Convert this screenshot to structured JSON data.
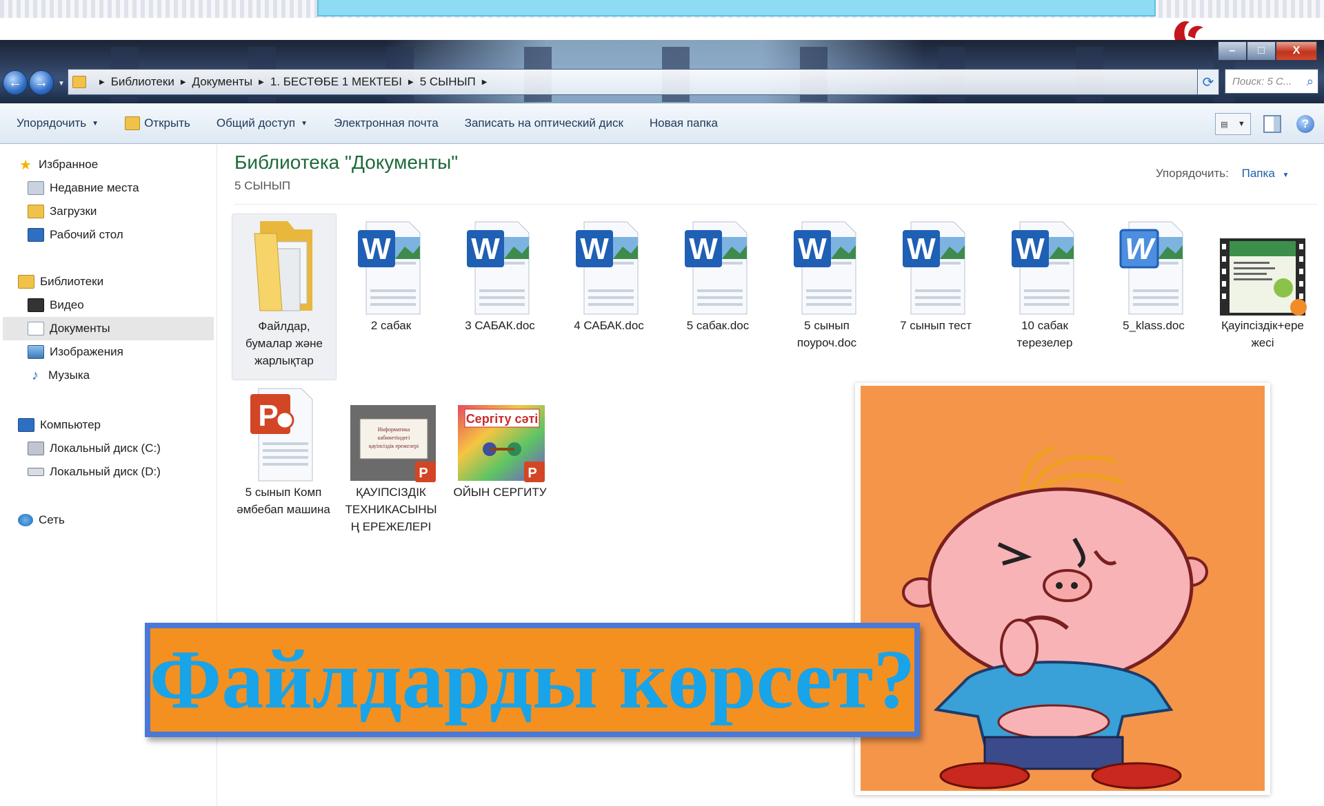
{
  "window": {
    "controls": {
      "minimize": "–",
      "maximize": "□",
      "close": "X"
    },
    "nav": {
      "back": "←",
      "forward": "→"
    },
    "address": {
      "crumbs": [
        "Библиотеки",
        "Документы",
        "1. БЕСТӨБЕ 1 МЕКТЕБІ",
        "5 СЫНЫП"
      ]
    },
    "search_placeholder": "Поиск: 5 С...",
    "refresh": "⟳"
  },
  "toolbar": {
    "organize": "Упорядочить",
    "open": "Открыть",
    "share": "Общий доступ",
    "email": "Электронная почта",
    "burn": "Записать на оптический диск",
    "new_folder": "Новая папка",
    "help": "?"
  },
  "sidebar": {
    "favorites": {
      "header": "Избранное",
      "items": [
        "Недавние места",
        "Загрузки",
        "Рабочий стол"
      ]
    },
    "libraries": {
      "header": "Библиотеки",
      "items": [
        "Видео",
        "Документы",
        "Изображения",
        "Музыка"
      ],
      "selected": "Документы"
    },
    "computer": {
      "header": "Компьютер",
      "items": [
        "Локальный диск (C:)",
        "Локальный диск (D:)"
      ]
    },
    "network": {
      "header": "Сеть"
    }
  },
  "content": {
    "title": "Библиотека \"Документы\"",
    "subtitle": "5 СЫНЫП",
    "arrange_label": "Упорядочить:",
    "arrange_value": "Папка",
    "files": [
      {
        "label": "Файлдар, бумалар және жарлықтар",
        "type": "folder"
      },
      {
        "label": "2 сабак",
        "type": "word"
      },
      {
        "label": "3 САБАК.doc",
        "type": "word"
      },
      {
        "label": "4 САБАК.doc",
        "type": "word"
      },
      {
        "label": "5 сабак.doc",
        "type": "word"
      },
      {
        "label": "5 сынып поуроч.doc",
        "type": "word"
      },
      {
        "label": "7 сынып тест",
        "type": "word"
      },
      {
        "label": "10 сабак терезелер",
        "type": "word"
      },
      {
        "label": "5_klass.doc",
        "type": "word-legacy"
      },
      {
        "label": "Қауіпсіздік+ере жесі",
        "type": "video"
      },
      {
        "label": "5 сынып Комп әмбебап машина",
        "type": "powerpoint"
      },
      {
        "label": "ҚАУІПСІЗДІК ТЕХНИКАСЫНЫ Ң ЕРЕЖЕЛЕРІ",
        "type": "powerpoint-thumb"
      },
      {
        "label": "ОЙЫН СЕРГИТУ",
        "type": "powerpoint-thumb"
      }
    ],
    "thumbnail_texts": {
      "kauipsizdik_thumb": "Информатика кабинетіндегі қауіпсіздік ережелері",
      "sergitu_thumb": "Сергіту сәті"
    }
  },
  "overlay": {
    "question": "Файлдарды көрсет?"
  },
  "colors": {
    "accent_title": "#1e6a3a",
    "banner_bg": "#f39020",
    "banner_border": "#4a78d6",
    "banner_text": "#19a3e8",
    "cartoon_bg": "#f5954a"
  }
}
